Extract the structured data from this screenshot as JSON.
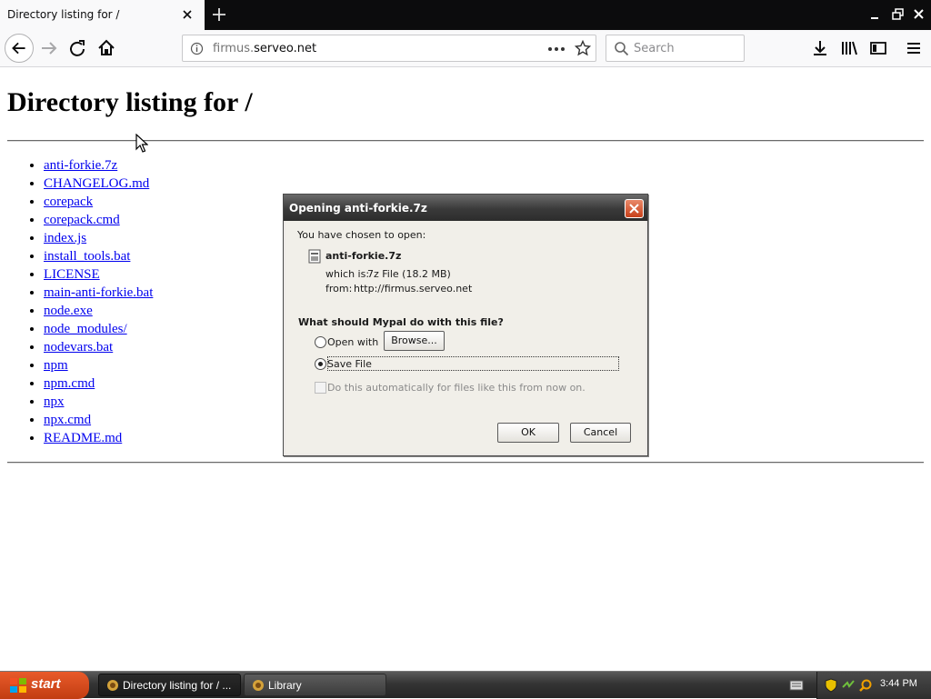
{
  "browser": {
    "tab_title": "Directory listing for /",
    "url_host_dim": "firmus.",
    "url_host_main": "serveo.net",
    "search_placeholder": "Search"
  },
  "page": {
    "heading": "Directory listing for /",
    "files": [
      "anti-forkie.7z",
      "CHANGELOG.md",
      "corepack",
      "corepack.cmd",
      "index.js",
      "install_tools.bat",
      "LICENSE",
      "main-anti-forkie.bat",
      "node.exe",
      "node_modules/",
      "nodevars.bat",
      "npm",
      "npm.cmd",
      "npx",
      "npx.cmd",
      "README.md"
    ]
  },
  "dialog": {
    "title": "Opening anti-forkie.7z",
    "chosen_text": "You have chosen to open:",
    "filename": "anti-forkie.7z",
    "which_is_label": "which is:",
    "which_is_value": "7z File (18.2 MB)",
    "from_label": "from:",
    "from_value": "http://firmus.serveo.net",
    "question": "What should Mypal do with this file?",
    "open_with_label": "Open with",
    "browse_button": "Browse...",
    "save_file_label": "Save File",
    "auto_label": "Do this automatically for files like this from now on.",
    "ok_button": "OK",
    "cancel_button": "Cancel",
    "selected_option": "Save File"
  },
  "taskbar": {
    "start_label": "start",
    "tasks": [
      "Directory listing for / ...",
      "Library"
    ],
    "clock": "3:44 PM"
  },
  "colors": {
    "link": "#0000ee",
    "start_button": "#c23d12",
    "close_button": "#c8401a"
  }
}
